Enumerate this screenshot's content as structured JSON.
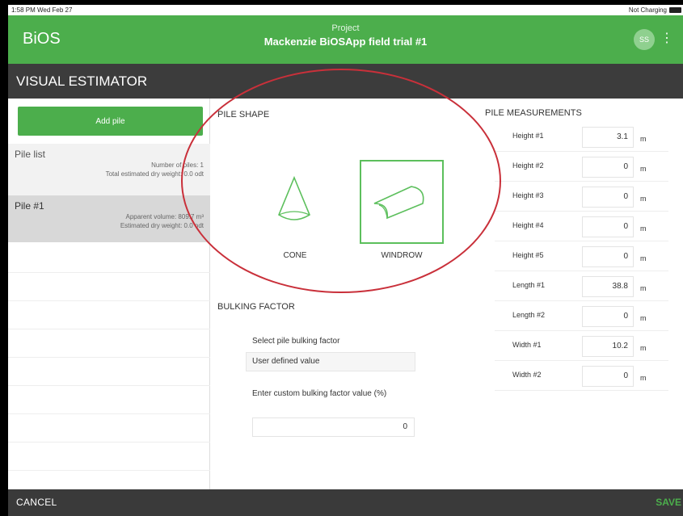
{
  "status_bar": {
    "time": "1:58 PM  Wed Feb 27",
    "network": "Not Charging"
  },
  "app_bar": {
    "title": "BiOS",
    "project_label": "Project",
    "project_name": "Mackenzie BiOSApp field trial #1",
    "avatar_initials": "SS"
  },
  "section": {
    "title": "VISUAL ESTIMATOR"
  },
  "left": {
    "add_pile_label": "Add pile",
    "pile_list": {
      "title": "Pile list",
      "num_piles": "Number of piles:   1",
      "total_weight": "Total estimated dry weight: 0.0  odt"
    },
    "pile": {
      "title": "Pile #1",
      "apparent_volume": "Apparent volume:  809.7 m³",
      "estimated_dry_weight": "Estimated dry weight:      0.0  odt"
    }
  },
  "pile_shape": {
    "title": "PILE SHAPE",
    "options": [
      {
        "label": "CONE",
        "selected": false
      },
      {
        "label": "WINDROW",
        "selected": true
      }
    ]
  },
  "bulking": {
    "title": "BULKING FACTOR",
    "select_label": "Select pile bulking factor",
    "selected_value": "User defined value",
    "custom_label": "Enter custom bulking factor value (%)",
    "custom_value": "0"
  },
  "measurements": {
    "title": "PILE MEASUREMENTS",
    "rows": [
      {
        "label": "Height #1",
        "value": "3.1",
        "unit": "m"
      },
      {
        "label": "Height #2",
        "value": "0",
        "unit": "m"
      },
      {
        "label": "Height #3",
        "value": "0",
        "unit": "m"
      },
      {
        "label": "Height #4",
        "value": "0",
        "unit": "m"
      },
      {
        "label": "Height #5",
        "value": "0",
        "unit": "m"
      },
      {
        "label": "Length #1",
        "value": "38.8",
        "unit": "m"
      },
      {
        "label": "Length #2",
        "value": "0",
        "unit": "m"
      },
      {
        "label": "Width #1",
        "value": "10.2",
        "unit": "m"
      },
      {
        "label": "Width #2",
        "value": "0",
        "unit": "m"
      }
    ]
  },
  "bottom_bar": {
    "cancel_label": "CANCEL",
    "save_label": "SAVE"
  },
  "colors": {
    "brand_green": "#4cae4c",
    "header_dark": "#3c3c3c",
    "annotation_red": "#c9303a"
  }
}
